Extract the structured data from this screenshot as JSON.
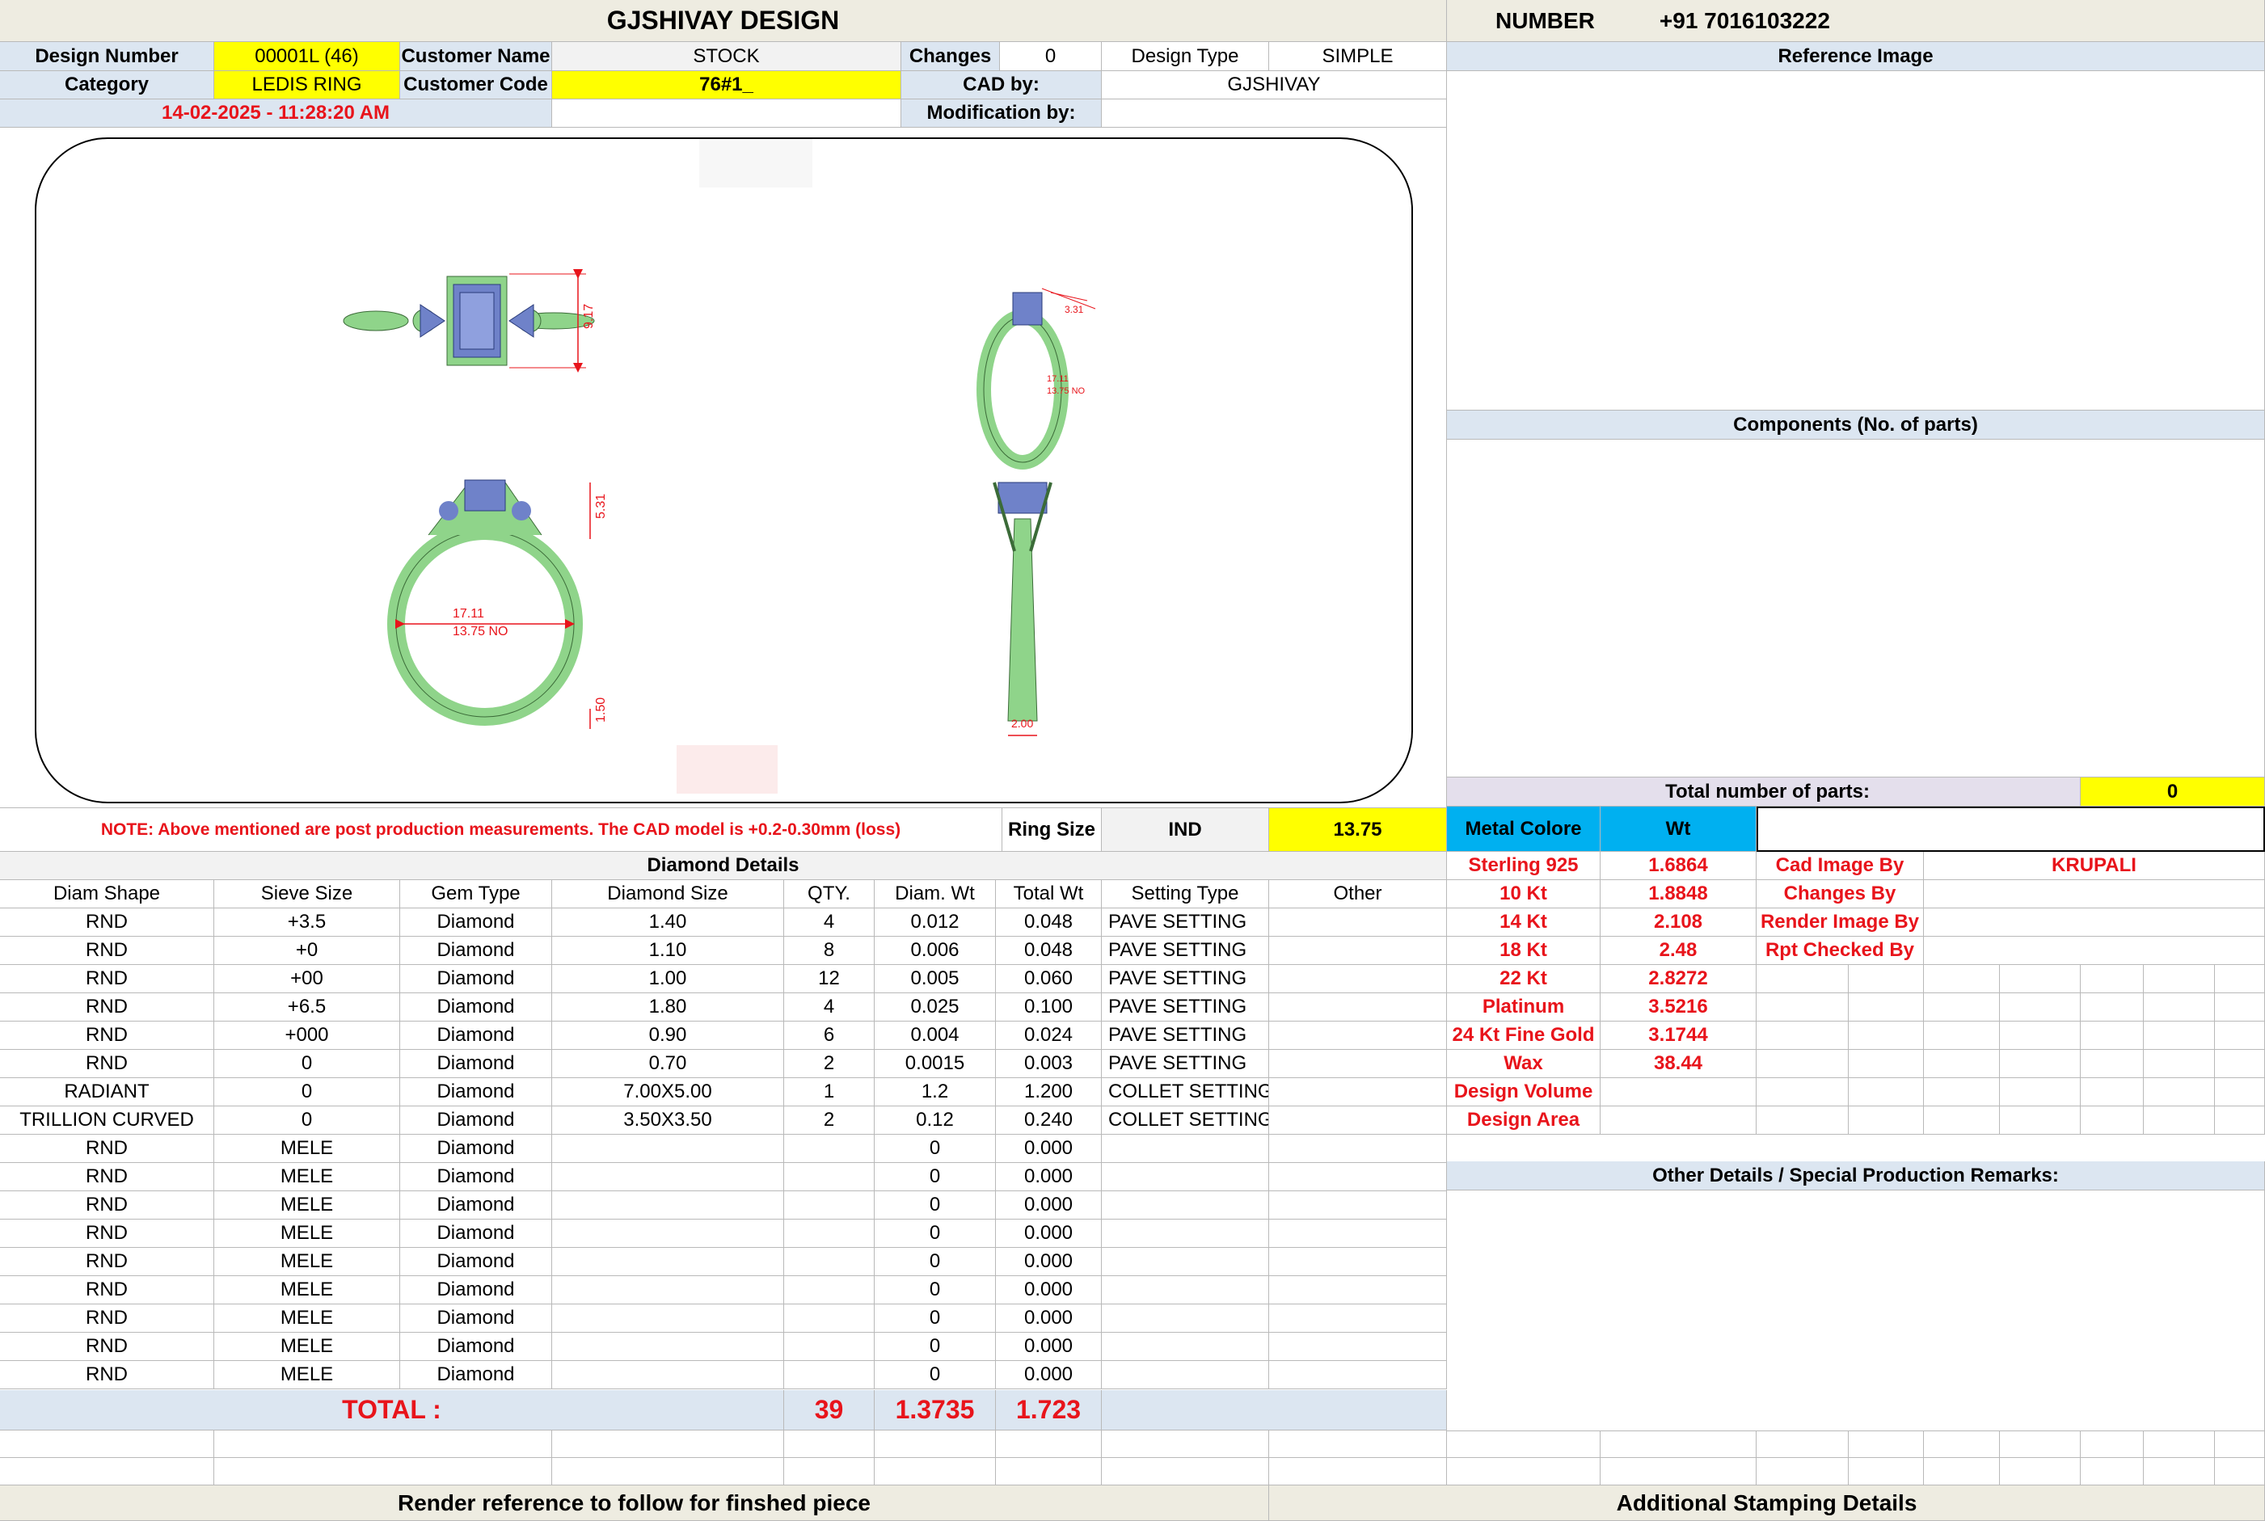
{
  "header": {
    "title": "GJSHIVAY DESIGN",
    "number_label": "NUMBER",
    "phone": "+91 7016103222"
  },
  "info": {
    "design_number_label": "Design Number",
    "design_number": "00001L (46)",
    "customer_name_label": "Customer Name",
    "customer_name": "STOCK",
    "changes_label": "Changes",
    "changes": "0",
    "design_type_label": "Design Type",
    "design_type": "SIMPLE",
    "category_label": "Category",
    "category": "LEDIS RING",
    "customer_code_label": "Customer Code",
    "customer_code": "76#1_",
    "cad_by_label": "CAD by:",
    "cad_by": "GJSHIVAY",
    "datetime": "14-02-2025 - 11:28:20 AM",
    "modification_label": "Modification by:",
    "modification": ""
  },
  "cad": {
    "dims": {
      "top_width": "9.17",
      "side_height": "5.31",
      "ring_dia": "17.11",
      "ring_no": "13.75 NO",
      "shank_bottom": "1.50",
      "shank_width": "2.00",
      "small_a": "3.31",
      "small_b": "5.31",
      "small_c": "1.50"
    }
  },
  "note": "NOTE: Above mentioned are post production measurements. The CAD model is +0.2-0.30mm (loss)",
  "ring_size": {
    "label": "Ring Size",
    "standard": "IND",
    "value": "13.75"
  },
  "right_panel": {
    "reference_image_label": "Reference Image",
    "components_label": "Components (No. of parts)",
    "total_parts_label": "Total number of parts:",
    "total_parts": "0",
    "metal_colore_label": "Metal Colore",
    "wt_label": "Wt",
    "metals": [
      {
        "name": "Sterling 925",
        "wt": "1.6864"
      },
      {
        "name": "10 Kt",
        "wt": "1.8848"
      },
      {
        "name": "14 Kt",
        "wt": "2.108"
      },
      {
        "name": "18 Kt",
        "wt": "2.48"
      },
      {
        "name": "22 Kt",
        "wt": "2.8272"
      },
      {
        "name": "Platinum",
        "wt": "3.5216"
      },
      {
        "name": "24 Kt Fine Gold",
        "wt": "3.1744"
      },
      {
        "name": "Wax",
        "wt": "38.44"
      },
      {
        "name": "Design Volume",
        "wt": ""
      },
      {
        "name": "Design Area",
        "wt": ""
      }
    ],
    "credits": [
      {
        "label": "Cad Image By",
        "value": "KRUPALI"
      },
      {
        "label": "Changes By",
        "value": ""
      },
      {
        "label": "Render Image By",
        "value": ""
      },
      {
        "label": "Rpt Checked By",
        "value": ""
      }
    ],
    "remarks_label": "Other Details / Special Production Remarks:"
  },
  "diamonds": {
    "section_title": "Diamond Details",
    "headers": [
      "Diam Shape",
      "Sieve Size",
      "Gem Type",
      "Diamond Size",
      "QTY.",
      "Diam. Wt",
      "Total Wt",
      "Setting Type",
      "Other"
    ],
    "rows": [
      [
        "RND",
        "+3.5",
        "Diamond",
        "1.40",
        "4",
        "0.012",
        "0.048",
        "PAVE SETTING",
        ""
      ],
      [
        "RND",
        "+0",
        "Diamond",
        "1.10",
        "8",
        "0.006",
        "0.048",
        "PAVE SETTING",
        ""
      ],
      [
        "RND",
        "+00",
        "Diamond",
        "1.00",
        "12",
        "0.005",
        "0.060",
        "PAVE SETTING",
        ""
      ],
      [
        "RND",
        "+6.5",
        "Diamond",
        "1.80",
        "4",
        "0.025",
        "0.100",
        "PAVE SETTING",
        ""
      ],
      [
        "RND",
        "+000",
        "Diamond",
        "0.90",
        "6",
        "0.004",
        "0.024",
        "PAVE SETTING",
        ""
      ],
      [
        "RND",
        "0",
        "Diamond",
        "0.70",
        "2",
        "0.0015",
        "0.003",
        "PAVE SETTING",
        ""
      ],
      [
        "RADIANT",
        "0",
        "Diamond",
        "7.00X5.00",
        "1",
        "1.2",
        "1.200",
        "COLLET SETTING",
        ""
      ],
      [
        "TRILLION CURVED",
        "0",
        "Diamond",
        "3.50X3.50",
        "2",
        "0.12",
        "0.240",
        "COLLET SETTING",
        ""
      ],
      [
        "RND",
        "MELE",
        "Diamond",
        "",
        "",
        "0",
        "0.000",
        "",
        ""
      ],
      [
        "RND",
        "MELE",
        "Diamond",
        "",
        "",
        "0",
        "0.000",
        "",
        ""
      ],
      [
        "RND",
        "MELE",
        "Diamond",
        "",
        "",
        "0",
        "0.000",
        "",
        ""
      ],
      [
        "RND",
        "MELE",
        "Diamond",
        "",
        "",
        "0",
        "0.000",
        "",
        ""
      ],
      [
        "RND",
        "MELE",
        "Diamond",
        "",
        "",
        "0",
        "0.000",
        "",
        ""
      ],
      [
        "RND",
        "MELE",
        "Diamond",
        "",
        "",
        "0",
        "0.000",
        "",
        ""
      ],
      [
        "RND",
        "MELE",
        "Diamond",
        "",
        "",
        "0",
        "0.000",
        "",
        ""
      ],
      [
        "RND",
        "MELE",
        "Diamond",
        "",
        "",
        "0",
        "0.000",
        "",
        ""
      ],
      [
        "RND",
        "MELE",
        "Diamond",
        "",
        "",
        "0",
        "0.000",
        "",
        ""
      ]
    ],
    "total_label": "TOTAL :",
    "total_qty": "39",
    "total_diam_wt": "1.3735",
    "total_wt": "1.723"
  },
  "footer": {
    "render_note": "Render reference to follow for finshed piece",
    "stamping": "Additional Stamping Details"
  }
}
